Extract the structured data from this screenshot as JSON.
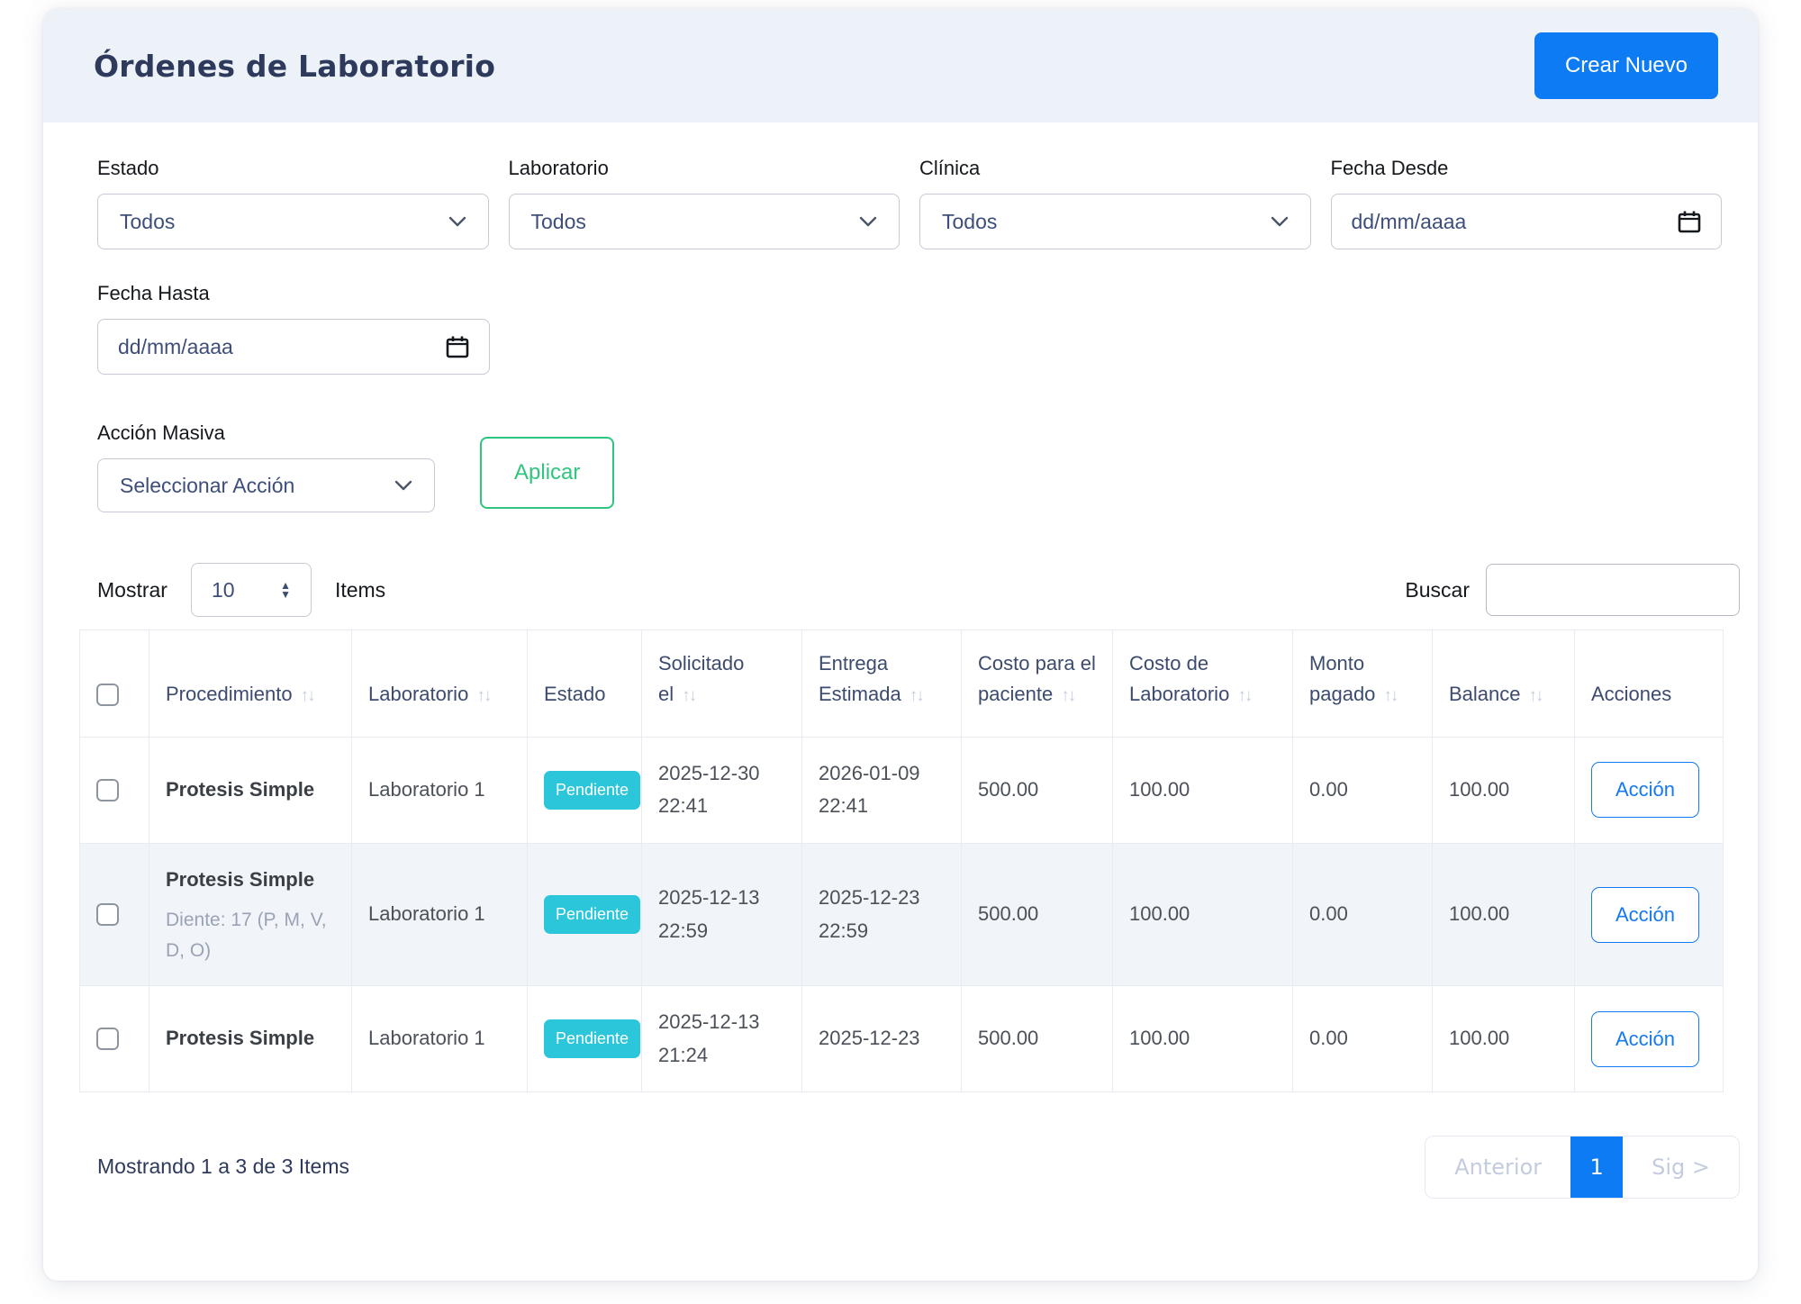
{
  "header": {
    "title": "Órdenes de Laboratorio",
    "create_button": "Crear Nuevo"
  },
  "filters": {
    "estado": {
      "label": "Estado",
      "value": "Todos"
    },
    "laboratorio": {
      "label": "Laboratorio",
      "value": "Todos"
    },
    "clinica": {
      "label": "Clínica",
      "value": "Todos"
    },
    "fecha_desde": {
      "label": "Fecha Desde",
      "placeholder": "dd/mm/aaaa"
    },
    "fecha_hasta": {
      "label": "Fecha Hasta",
      "placeholder": "dd/mm/aaaa"
    }
  },
  "bulk_action": {
    "label": "Acción Masiva",
    "select_value": "Seleccionar Acción",
    "apply_button": "Aplicar"
  },
  "list_controls": {
    "show_label": "Mostrar",
    "page_size": "10",
    "items_label": "Items",
    "search_label": "Buscar",
    "search_value": ""
  },
  "table": {
    "headers": [
      {
        "label": "Procedimiento",
        "sortable": true
      },
      {
        "label": "Laboratorio",
        "sortable": true
      },
      {
        "label": "Estado",
        "sortable": false
      },
      {
        "label": "Solicitado el",
        "sortable": true
      },
      {
        "label": "Entrega Estimada",
        "sortable": true
      },
      {
        "label": "Costo para el paciente",
        "sortable": true
      },
      {
        "label": "Costo de Laboratorio",
        "sortable": true
      },
      {
        "label": "Monto pagado",
        "sortable": true
      },
      {
        "label": "Balance",
        "sortable": true
      },
      {
        "label": "Acciones",
        "sortable": false
      }
    ],
    "rows": [
      {
        "procedimiento": "Protesis Simple",
        "detalle": "",
        "laboratorio": "Laboratorio 1",
        "estado": "Pendiente",
        "solicitado": "2025-12-30 22:41",
        "entrega": "2026-01-09 22:41",
        "costo_paciente": "500.00",
        "costo_laboratorio": "100.00",
        "monto_pagado": "0.00",
        "balance": "100.00",
        "accion": "Acción"
      },
      {
        "procedimiento": "Protesis Simple",
        "detalle": "Diente: 17 (P, M, V, D, O)",
        "laboratorio": "Laboratorio 1",
        "estado": "Pendiente",
        "solicitado": "2025-12-13 22:59",
        "entrega": "2025-12-23 22:59",
        "costo_paciente": "500.00",
        "costo_laboratorio": "100.00",
        "monto_pagado": "0.00",
        "balance": "100.00",
        "accion": "Acción"
      },
      {
        "procedimiento": "Protesis Simple",
        "detalle": "",
        "laboratorio": "Laboratorio 1",
        "estado": "Pendiente",
        "solicitado": "2025-12-13 21:24",
        "entrega": "2025-12-23",
        "costo_paciente": "500.00",
        "costo_laboratorio": "100.00",
        "monto_pagado": "0.00",
        "balance": "100.00",
        "accion": "Acción"
      }
    ],
    "sort_icon": "↑↓"
  },
  "footer": {
    "summary": "Mostrando 1 a 3 de 3 Items",
    "pagination": {
      "prev": "Anterior",
      "page": "1",
      "next": "Sig >"
    }
  },
  "colors": {
    "primary_blue": "#0d7bf3",
    "action_blue": "#1479f2",
    "apply_green": "#2fc57d",
    "badge_cyan": "#2bc6d9",
    "header_band": "#edf1f8",
    "stripe_row": "#f1f4f9",
    "title_navy": "#2e3a5c",
    "muted_lavender": "#c3cbe0"
  }
}
